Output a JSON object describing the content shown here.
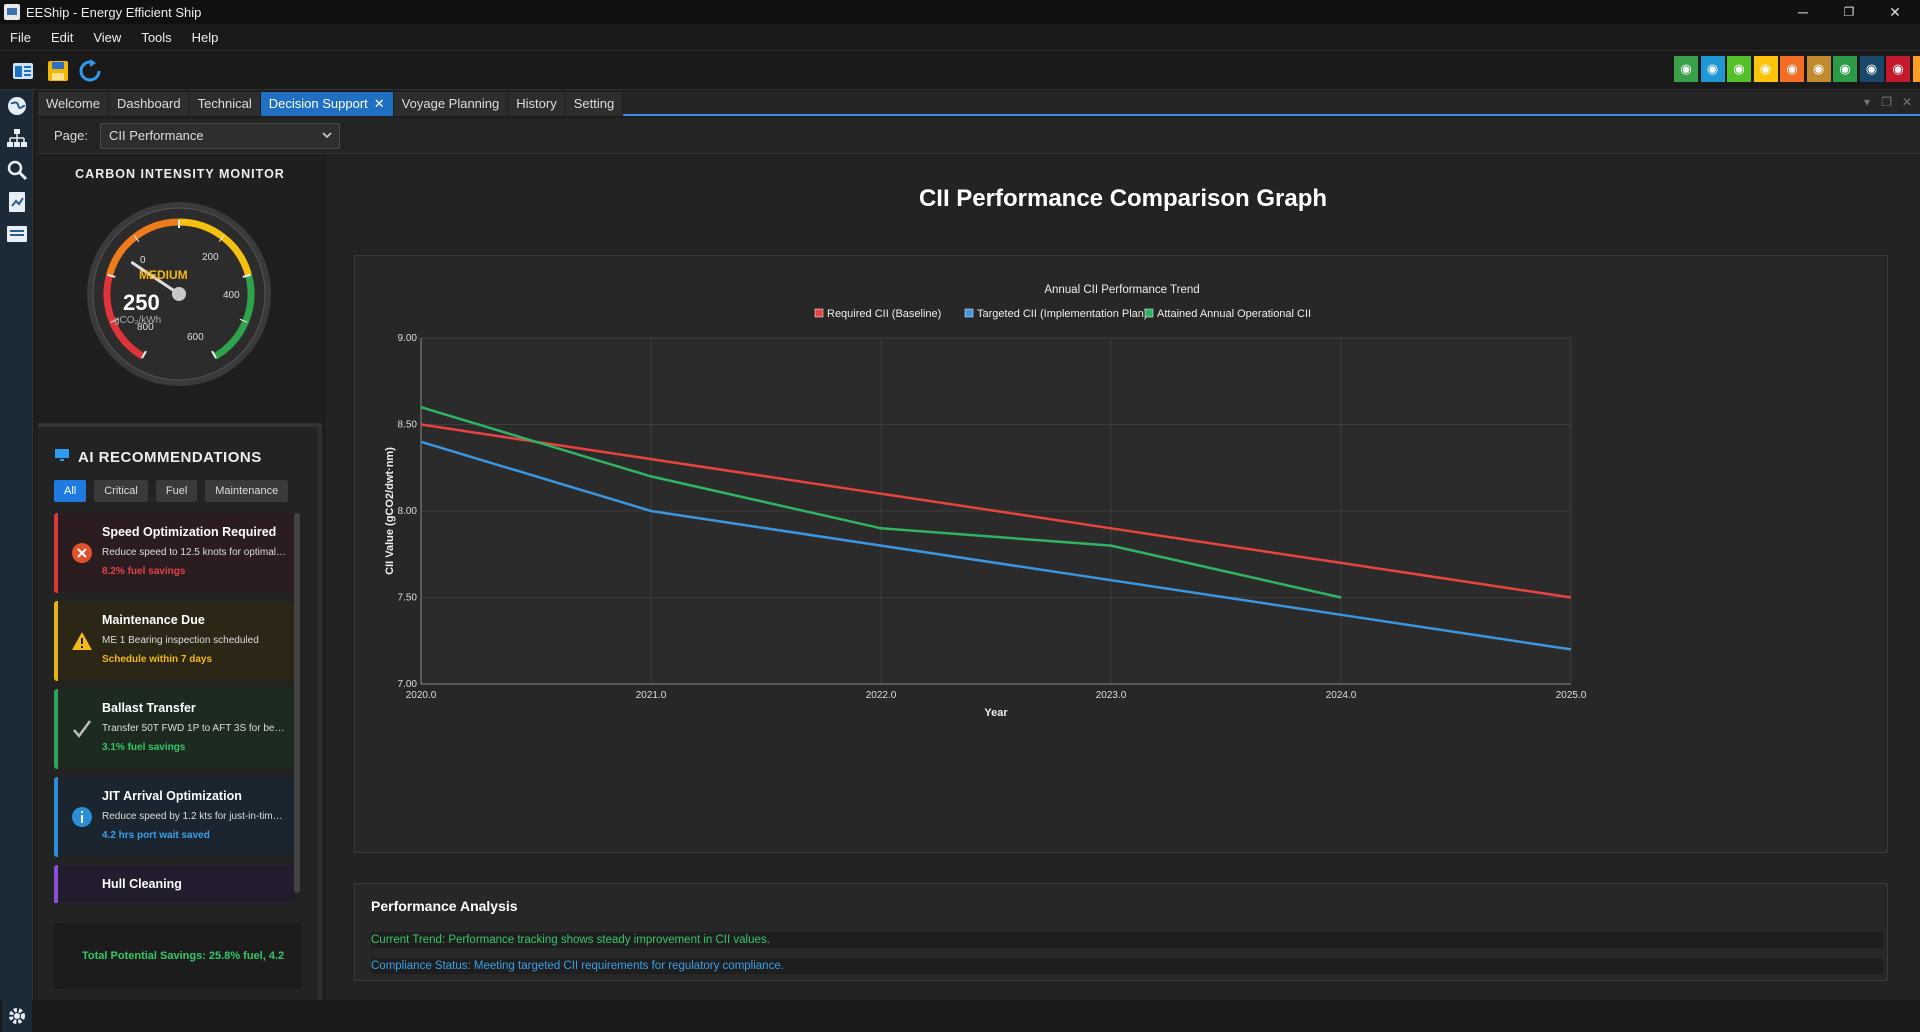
{
  "window": {
    "title": "EEShip - Energy Efficient Ship",
    "minimize": "─",
    "restore": "❐",
    "close": "✕"
  },
  "menu": [
    "File",
    "Edit",
    "View",
    "Tools",
    "Help"
  ],
  "tabs": [
    {
      "label": "Welcome"
    },
    {
      "label": "Dashboard"
    },
    {
      "label": "Technical"
    },
    {
      "label": "Decision Support",
      "active": true
    },
    {
      "label": "Voyage Planning"
    },
    {
      "label": "History"
    },
    {
      "label": "Setting"
    }
  ],
  "page_selector": {
    "label": "Page:",
    "value": "CII Performance"
  },
  "gauge": {
    "title": "CARBON INTENSITY MONITOR",
    "status": "MEDIUM",
    "value": "250",
    "unit": "gCO₂/kWh",
    "ticks": [
      "0",
      "200",
      "400",
      "600",
      "800"
    ],
    "reading": 250,
    "max": 800
  },
  "ai": {
    "title": "AI RECOMMENDATIONS",
    "filters": [
      "All",
      "Critical",
      "Fuel",
      "Maintenance"
    ],
    "recommendations": [
      {
        "title": "Speed Optimization Required",
        "desc": "Reduce speed to 12.5 knots for optimal …",
        "stat": "8.2% fuel savings",
        "color": "#d63b3b",
        "bg": "#2b1d1f",
        "statcolor": "#e0434a",
        "icon": "close-icon"
      },
      {
        "title": "Maintenance Due",
        "desc": "ME 1 Bearing inspection scheduled",
        "stat": "Schedule within 7 days",
        "color": "#e7b416",
        "bg": "#2b2616",
        "statcolor": "#f3b916",
        "icon": "warning-icon"
      },
      {
        "title": "Ballast Transfer",
        "desc": "Transfer 50T FWD 1P to AFT 3S for bette…",
        "stat": "3.1% fuel savings",
        "color": "#2fa35a",
        "bg": "#1c2a20",
        "statcolor": "#36c66a",
        "icon": "check-icon"
      },
      {
        "title": "JIT Arrival Optimization",
        "desc": "Reduce speed by 1.2 kts for just-in-time…",
        "stat": "4.2 hrs port wait saved",
        "color": "#2a8fd6",
        "bg": "#1b2530",
        "statcolor": "#3aa0e8",
        "icon": "info-icon"
      },
      {
        "title": "Hull Cleaning",
        "desc": "",
        "stat": "",
        "color": "#8a4fd6",
        "bg": "#221c2e",
        "statcolor": "#a070e0",
        "icon": "hull-icon"
      }
    ],
    "total_savings": "Total Potential Savings: 25.8% fuel, 4.2"
  },
  "graph_title": "CII Performance Comparison Graph",
  "chart_data": {
    "type": "line",
    "title": "Annual CII Performance Trend",
    "xlabel": "Year",
    "ylabel": "CII Value (gCO2/dwt·nm)",
    "xlim": [
      2020,
      2025
    ],
    "ylim": [
      7.0,
      9.0
    ],
    "xticks": [
      "2020.0",
      "2021.0",
      "2022.0",
      "2023.0",
      "2024.0",
      "2025.0"
    ],
    "yticks": [
      "7.00",
      "7.50",
      "8.00",
      "8.50",
      "9.00"
    ],
    "grid": true,
    "legend": "top-center",
    "series": [
      {
        "name": "Required CII (Baseline)",
        "color": "#e8433f",
        "x": [
          2020,
          2021,
          2022,
          2023,
          2024,
          2025
        ],
        "values": [
          8.5,
          8.3,
          8.1,
          7.9,
          7.7,
          7.5
        ]
      },
      {
        "name": "Targeted CII (Implementation Plan)",
        "color": "#3a96e0",
        "x": [
          2020,
          2021,
          2022,
          2023,
          2024,
          2025
        ],
        "values": [
          8.4,
          8.0,
          7.8,
          7.6,
          7.4,
          7.2
        ]
      },
      {
        "name": "Attained Annual Operational CII",
        "color": "#2fb463",
        "x": [
          2020,
          2021,
          2022,
          2023,
          2024
        ],
        "values": [
          8.6,
          8.2,
          7.9,
          7.8,
          7.5
        ]
      }
    ]
  },
  "performance": {
    "title": "Performance Analysis",
    "trend": "Current Trend: Performance tracking shows steady improvement in CII values.",
    "compliance": "Compliance Status: Meeting targeted CII requirements for regulatory compliance.",
    "trend_color": "#36c66a",
    "compliance_color": "#3aa0e8"
  },
  "toolbar": {
    "icons": [
      "open-icon",
      "save-icon",
      "refresh-icon"
    ],
    "sdg_colors": [
      "#3aa04a",
      "#1f97d4",
      "#56c02b",
      "#fcc30b",
      "#f36d25",
      "#bf8b2e",
      "#2c9a47",
      "#19486a",
      "#c5192d",
      "#fd9d24"
    ]
  }
}
